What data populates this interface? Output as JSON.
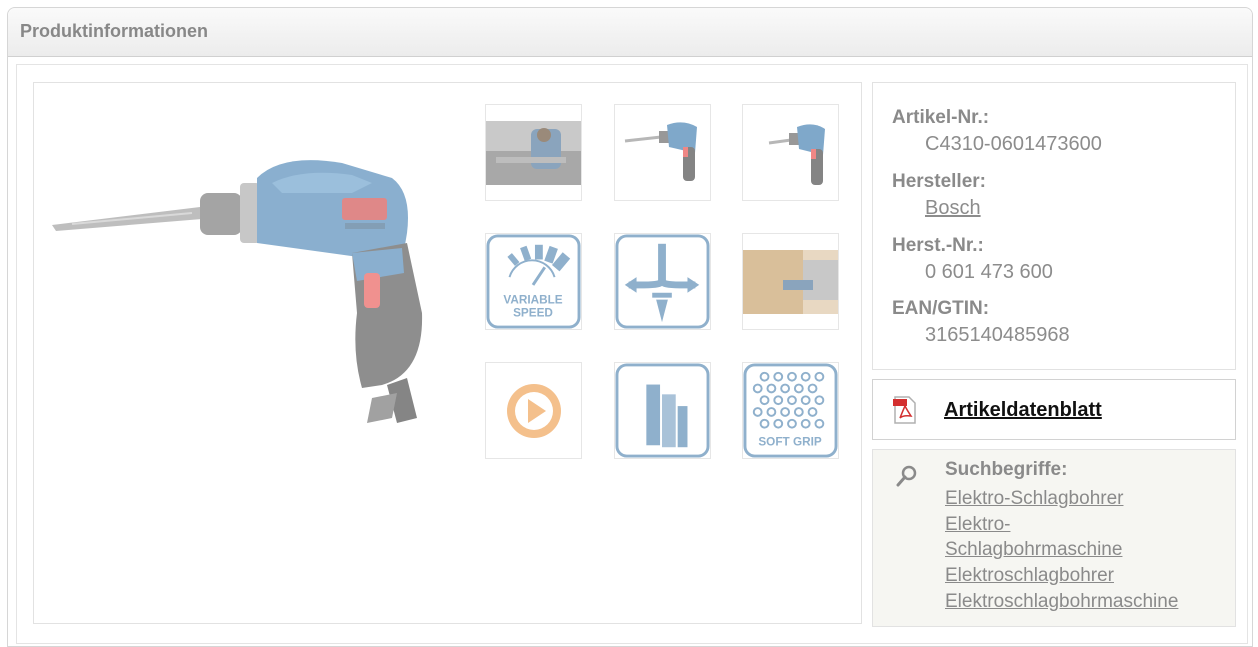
{
  "header": {
    "title": "Produktinformationen"
  },
  "gallery": {
    "main_image": "drill-product-image",
    "thumbnails": [
      {
        "name": "thumb-application-photo",
        "icon": "application-photo"
      },
      {
        "name": "thumb-drill-view-1",
        "icon": "drill-image"
      },
      {
        "name": "thumb-drill-view-2",
        "icon": "drill-image"
      },
      {
        "name": "thumb-variable-speed",
        "icon": "variable-speed-icon",
        "text": [
          "VARIABLE",
          "SPEED"
        ]
      },
      {
        "name": "thumb-drilling-directions",
        "icon": "drilling-directions-icon"
      },
      {
        "name": "thumb-wood-application",
        "icon": "wood-application-photo"
      },
      {
        "name": "thumb-video",
        "icon": "play-icon"
      },
      {
        "name": "thumb-materials",
        "icon": "materials-icon"
      },
      {
        "name": "thumb-soft-grip",
        "icon": "soft-grip-icon",
        "text": [
          "SOFT GRIP"
        ]
      }
    ],
    "colors": {
      "icon_blue": "#8fb0cc",
      "play_orange": "#f4c08c"
    }
  },
  "info": {
    "article_label": "Artikel-Nr.:",
    "article_value": "C4310-0601473600",
    "manufacturer_label": "Hersteller:",
    "manufacturer_value": "Bosch",
    "manufacturer_no_label": "Herst.-Nr.:",
    "manufacturer_no_value": "0 601 473 600",
    "ean_label": "EAN/GTIN:",
    "ean_value": "3165140485968"
  },
  "datasheet": {
    "label": "Artikeldatenblatt",
    "icon": "pdf-icon"
  },
  "search": {
    "title": "Suchbegriffe:",
    "icon": "search-icon",
    "terms": [
      "Elektro-Schlagbohrer",
      "Elektro-",
      "Schlagbohrmaschine",
      "Elektroschlagbohrer",
      "Elektroschlagbohrmaschine"
    ]
  }
}
